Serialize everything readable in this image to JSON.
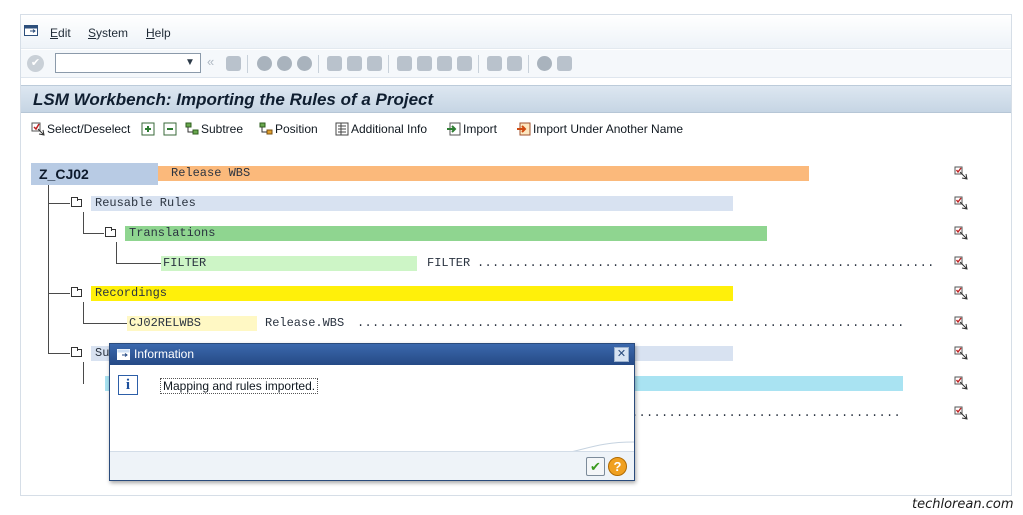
{
  "menu": {
    "items": [
      "Edit",
      "System",
      "Help"
    ]
  },
  "toolbar": {
    "command_field_value": ""
  },
  "title": "LSM Workbench: Importing the Rules of a Project",
  "app_toolbar": {
    "select_deselect": "Select/Deselect",
    "subtree": "Subtree",
    "position": "Position",
    "additional_info": "Additional Info",
    "import": "Import",
    "import_other": "Import Under Another Name"
  },
  "tree": {
    "root": "Z_CJ02",
    "root_desc": "Release WBS",
    "reusable_rules": "Reusable Rules",
    "translations": "Translations",
    "filter_name": "FILTER",
    "filter_desc": "FILTER",
    "recordings": "Recordings",
    "recording_name": "CJ02RELWBS",
    "recording_desc": "Release.WBS",
    "sub_partial": "Su"
  },
  "colors": {
    "root_desc_band": "#fbb97b",
    "reusable_band": "#d8e2f1",
    "translations_band": "#8fd590",
    "filter_band": "#cdf5c6",
    "recordings_band": "#fff00a",
    "recording_band": "#fff8c4",
    "sub_band": "#d8e2f1",
    "cyan_band": "#a9e3f2"
  },
  "dialog": {
    "title": "Information",
    "message": "Mapping and rules imported.",
    "close_icon": "close-icon",
    "info_icon": "info-icon"
  },
  "credit": "techlorean.com"
}
